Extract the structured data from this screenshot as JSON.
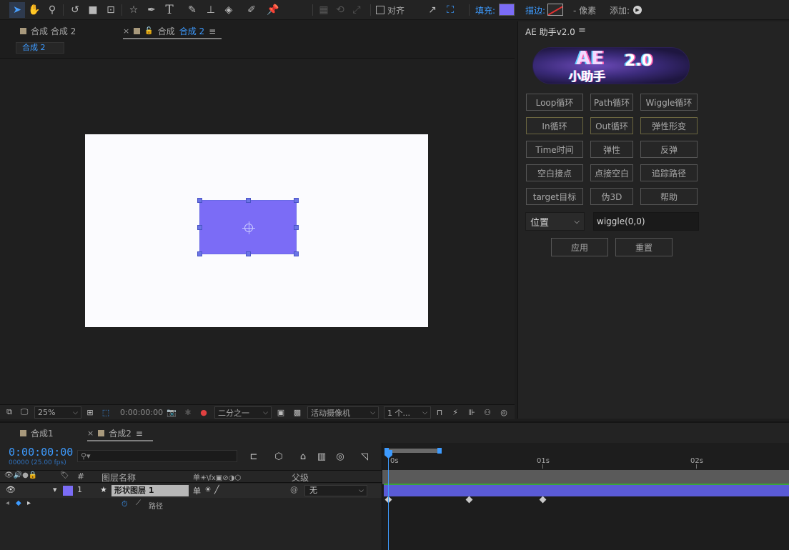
{
  "toolbar": {
    "align_label": "对齐",
    "fill_label": "填充:",
    "stroke_label": "描边:",
    "pixel_label": "- 像素",
    "add_label": "添加:",
    "fill_color": "#7b6cf6",
    "stroke_color": "#e03030",
    "tools": [
      "selection-tool-icon",
      "hand-tool-icon",
      "zoom-tool-icon",
      "rotate-tool-icon",
      "camera-tool-icon",
      "pan-behind-icon",
      "star-tool-icon",
      "pen-tool-icon",
      "text-tool-icon",
      "brush-tool-icon",
      "clone-stamp-icon",
      "eraser-icon",
      "roto-brush-icon",
      "puppet-pin-icon"
    ]
  },
  "comp_panel": {
    "tabs": [
      {
        "label": "合成 合成 2"
      },
      {
        "label_prefix": "合成",
        "label_active": "合成 2"
      }
    ],
    "breadcrumb": "合成 2",
    "zoom": "25%",
    "time": "0:00:00:00",
    "resolution": "二分之一",
    "camera": "活动摄像机",
    "views": "1 个..."
  },
  "helper": {
    "title": "AE 助手v2.0",
    "banner": {
      "main": "AE",
      "sub": "小助手",
      "deco": "2.0"
    },
    "buttons": [
      [
        "Loop循环",
        "Path循环",
        "Wiggle循环"
      ],
      [
        "In循环",
        "Out循环",
        "弹性形变"
      ],
      [
        "Time时间",
        "弹性",
        "反弹"
      ],
      [
        "空白接点",
        "点接空白",
        "追踪路径"
      ],
      [
        "target目标",
        "伪3D",
        "帮助"
      ]
    ],
    "property_select": "位置",
    "expression_value": "wiggle(0,0)",
    "apply_label": "应用",
    "reset_label": "重置"
  },
  "timeline": {
    "tabs": [
      {
        "label": "合成1"
      },
      {
        "label": "合成2"
      }
    ],
    "timecode": "0:00:00:00",
    "fps": "00000 (25.00 fps)",
    "search_placeholder": "",
    "columns": {
      "number": "#",
      "name": "图层名称",
      "switches": "单☀\\fx▣⊘◑⬡",
      "parent": "父级"
    },
    "layer": {
      "number": "1",
      "name": "形状图层 1",
      "parent": "无",
      "color": "#7b6cf6"
    },
    "property": {
      "name": "路径"
    },
    "ruler": [
      "0s",
      "01s",
      "02s"
    ]
  }
}
